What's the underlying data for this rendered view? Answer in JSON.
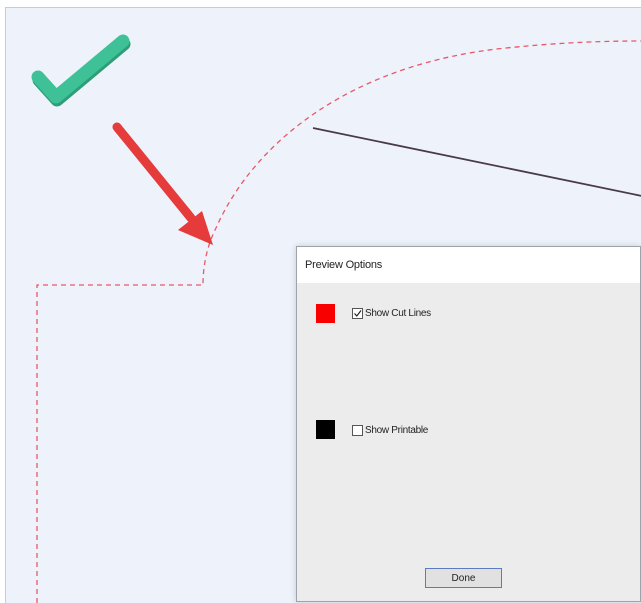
{
  "dialog": {
    "title": "Preview Options",
    "options": [
      {
        "label": "Show Cut Lines",
        "checked": true,
        "swatch_color": "#f80000"
      },
      {
        "label": "Show Printable",
        "checked": false,
        "swatch_color": "#000000"
      }
    ],
    "done_label": "Done"
  },
  "annotations": {
    "checkmark_color": "#3fc197",
    "arrow_color": "#e53b3b",
    "cut_line_color": "#e7586a"
  }
}
